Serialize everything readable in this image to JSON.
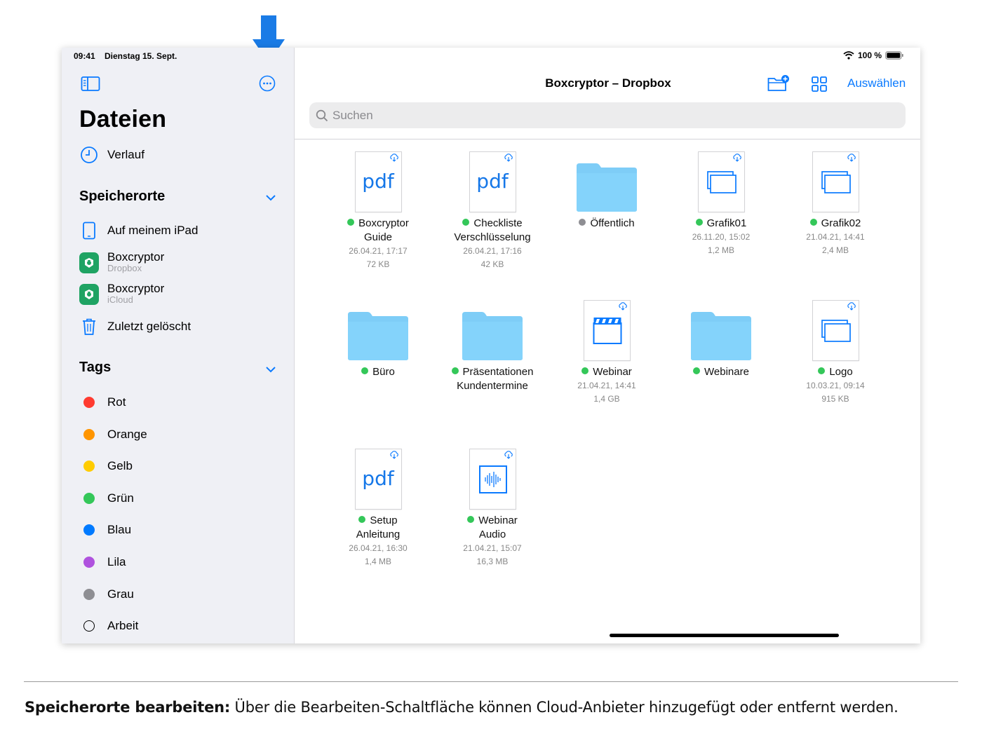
{
  "status": {
    "time": "09:41",
    "date": "Dienstag 15. Sept.",
    "battery": "100 %"
  },
  "sidebar": {
    "title": "Dateien",
    "recent": "Verlauf",
    "locations_header": "Speicherorte",
    "locations": [
      {
        "label": "Auf meinem iPad",
        "sub": "",
        "icon": "ipad-icon"
      },
      {
        "label": "Boxcryptor",
        "sub": "Dropbox",
        "icon": "boxcryptor-icon"
      },
      {
        "label": "Boxcryptor",
        "sub": "iCloud",
        "icon": "boxcryptor-icon"
      },
      {
        "label": "Zuletzt gelöscht",
        "sub": "",
        "icon": "trash-icon"
      }
    ],
    "tags_header": "Tags",
    "tags": [
      {
        "label": "Rot",
        "color": "#ff3b30"
      },
      {
        "label": "Orange",
        "color": "#ff9500"
      },
      {
        "label": "Gelb",
        "color": "#ffcc00"
      },
      {
        "label": "Grün",
        "color": "#34c759"
      },
      {
        "label": "Blau",
        "color": "#007aff"
      },
      {
        "label": "Lila",
        "color": "#af52de"
      },
      {
        "label": "Grau",
        "color": "#8e8e93"
      },
      {
        "label": "Arbeit",
        "color": ""
      }
    ]
  },
  "main": {
    "title": "Boxcryptor – Dropbox",
    "select": "Auswählen",
    "search_placeholder": "Suchen",
    "items": [
      {
        "name1": "Boxcryptor",
        "name2": "Guide",
        "date": "26.04.21, 17:17",
        "size": "72 KB",
        "kind": "pdf"
      },
      {
        "name1": "Checkliste",
        "name2": "Verschlüsselung",
        "date": "26.04.21, 17:16",
        "size": "42 KB",
        "kind": "pdf"
      },
      {
        "name1": "Öffentlich",
        "name2": "",
        "date": "",
        "size": "",
        "kind": "folder"
      },
      {
        "name1": "Grafik01",
        "name2": "",
        "date": "26.11.20, 15:02",
        "size": "1,2 MB",
        "kind": "image"
      },
      {
        "name1": "Grafik02",
        "name2": "",
        "date": "21.04.21, 14:41",
        "size": "2,4 MB",
        "kind": "image"
      },
      {
        "name1": "Büro",
        "name2": "",
        "date": "",
        "size": "",
        "kind": "folder"
      },
      {
        "name1": "Präsentationen",
        "name2": "Kundentermine",
        "date": "",
        "size": "",
        "kind": "folder"
      },
      {
        "name1": "Webinar",
        "name2": "",
        "date": "21.04.21, 14:41",
        "size": "1,4 GB",
        "kind": "video"
      },
      {
        "name1": "Webinare",
        "name2": "",
        "date": "",
        "size": "",
        "kind": "folder"
      },
      {
        "name1": "Logo",
        "name2": "",
        "date": "10.03.21, 09:14",
        "size": "915 KB",
        "kind": "image"
      },
      {
        "name1": "Setup",
        "name2": "Anleitung",
        "date": "26.04.21, 16:30",
        "size": "1,4 MB",
        "kind": "pdf"
      },
      {
        "name1": "Webinar",
        "name2": "Audio",
        "date": "21.04.21, 15:07",
        "size": "16,3 MB",
        "kind": "audio"
      }
    ],
    "pdf_label": "pdf"
  },
  "caption": {
    "bold": "Speicherorte bearbeiten:",
    "text": " Über die Bearbeiten-Schaltfläche können Cloud-Anbieter hinzugefügt oder entfernt werden."
  },
  "colors": {
    "accent": "#0a7aff",
    "folder": "#7ecdf7",
    "annotation_arrow": "#1a7be6"
  }
}
